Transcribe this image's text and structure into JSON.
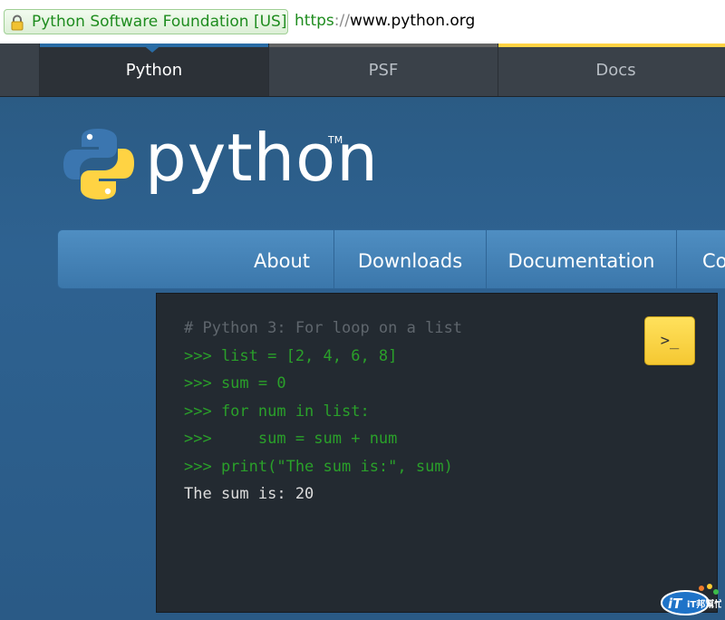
{
  "address_bar": {
    "ev_label": "Python Software Foundation [US]",
    "url_scheme": "https",
    "url_sep": "://",
    "url_host": "www.python.org"
  },
  "meta_nav": {
    "tabs": [
      {
        "label": "Python",
        "active": true,
        "accent": "#2a6ca5"
      },
      {
        "label": "PSF",
        "active": false,
        "accent": "#646565"
      },
      {
        "label": "Docs",
        "active": false,
        "accent": "#ffd343"
      }
    ]
  },
  "header": {
    "wordmark": "python",
    "trademark": "TM"
  },
  "main_nav": {
    "items": [
      "About",
      "Downloads",
      "Documentation",
      "Co"
    ]
  },
  "code": {
    "lines": [
      {
        "text": "# Python 3: For loop on a list",
        "kind": "comment"
      },
      {
        "text": ">>> list = [2, 4, 6, 8]",
        "kind": "prompt"
      },
      {
        "text": ">>> sum = 0",
        "kind": "prompt"
      },
      {
        "text": ">>> for num in list:",
        "kind": "prompt"
      },
      {
        "text": ">>>     sum = sum + num",
        "kind": "prompt"
      },
      {
        "text": ">>> print(\"The sum is:\", sum)",
        "kind": "prompt"
      },
      {
        "text": "The sum is: 20",
        "kind": "output"
      }
    ],
    "shell_button_label": ">_"
  },
  "colors": {
    "python_blue": "#2b5b84",
    "python_yellow": "#ffd343",
    "prompt_green": "#2aa02a"
  },
  "watermark": {
    "text": "iT邦幫忙"
  }
}
